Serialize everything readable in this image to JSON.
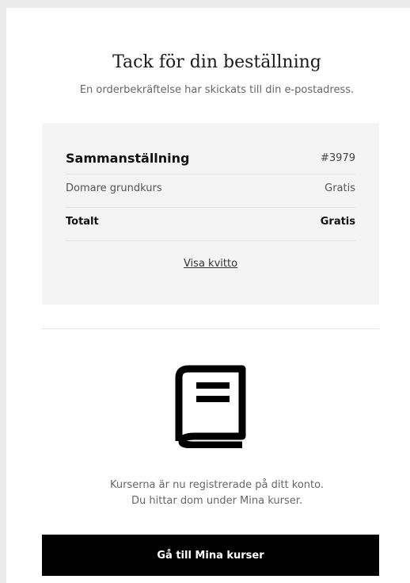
{
  "header": {
    "title": "Tack för din beställning",
    "subtitle": "En orderbekräftelse har skickats till din e-postadress."
  },
  "summary": {
    "heading": "Sammanställning",
    "order_number": "#3979",
    "items": [
      {
        "name": "Domare grundkurs",
        "price": "Gratis"
      }
    ],
    "total_label": "Totalt",
    "total_value": "Gratis",
    "receipt_link": "Visa kvitto"
  },
  "courses": {
    "icon": "book-icon",
    "line1": "Kurserna är nu registrerade på ditt konto.",
    "line2": "Du hittar dom under Mina kurser.",
    "button_label": "Gå till Mina kurser"
  }
}
